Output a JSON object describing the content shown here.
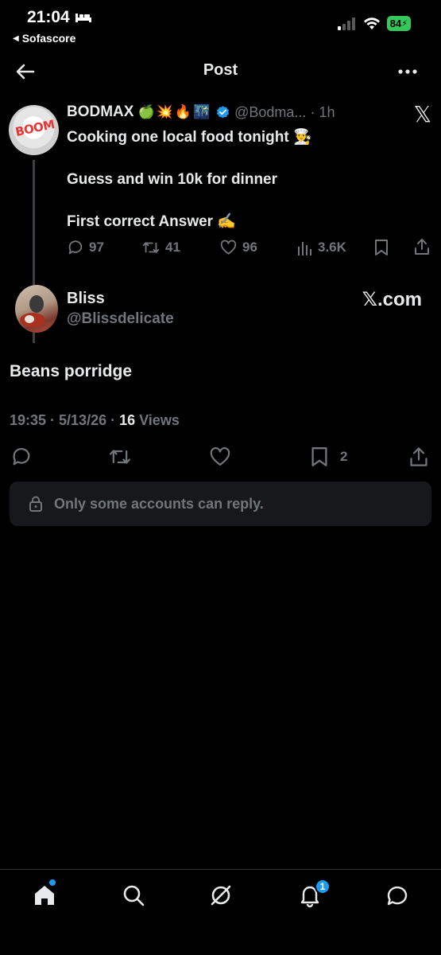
{
  "status_bar": {
    "time": "21:04",
    "back_app": "Sofascore",
    "battery": "84"
  },
  "header": {
    "title": "Post"
  },
  "original_post": {
    "name": "BODMAX",
    "emojis": "🍏💥🔥🌃",
    "handle": "@Bodma...",
    "time": "· 1h",
    "avatar_text": "BOOM",
    "lines": [
      "Cooking one local food tonight 👨‍🍳",
      "Guess and win 10k for dinner",
      "First correct Answer ✍️"
    ],
    "replies": "97",
    "reposts": "41",
    "likes": "96",
    "views": "3.6K"
  },
  "reply_post": {
    "name": "Bliss",
    "handle": "@Blissdelicate",
    "source": "𝕏.com",
    "text": "Beans porridge",
    "timestamp": "19:35 · 5/13/26 · ",
    "views_count": "16",
    "views_label": " Views",
    "bookmarks": "2"
  },
  "reply_restriction": {
    "text": "Only some accounts can reply."
  },
  "bottom_nav": {
    "notification_count": "1"
  },
  "colors": {
    "background": "#000000",
    "text_primary": "#e7e9ea",
    "text_secondary": "#71767b",
    "accent": "#1d9bf0",
    "battery": "#34c759"
  }
}
